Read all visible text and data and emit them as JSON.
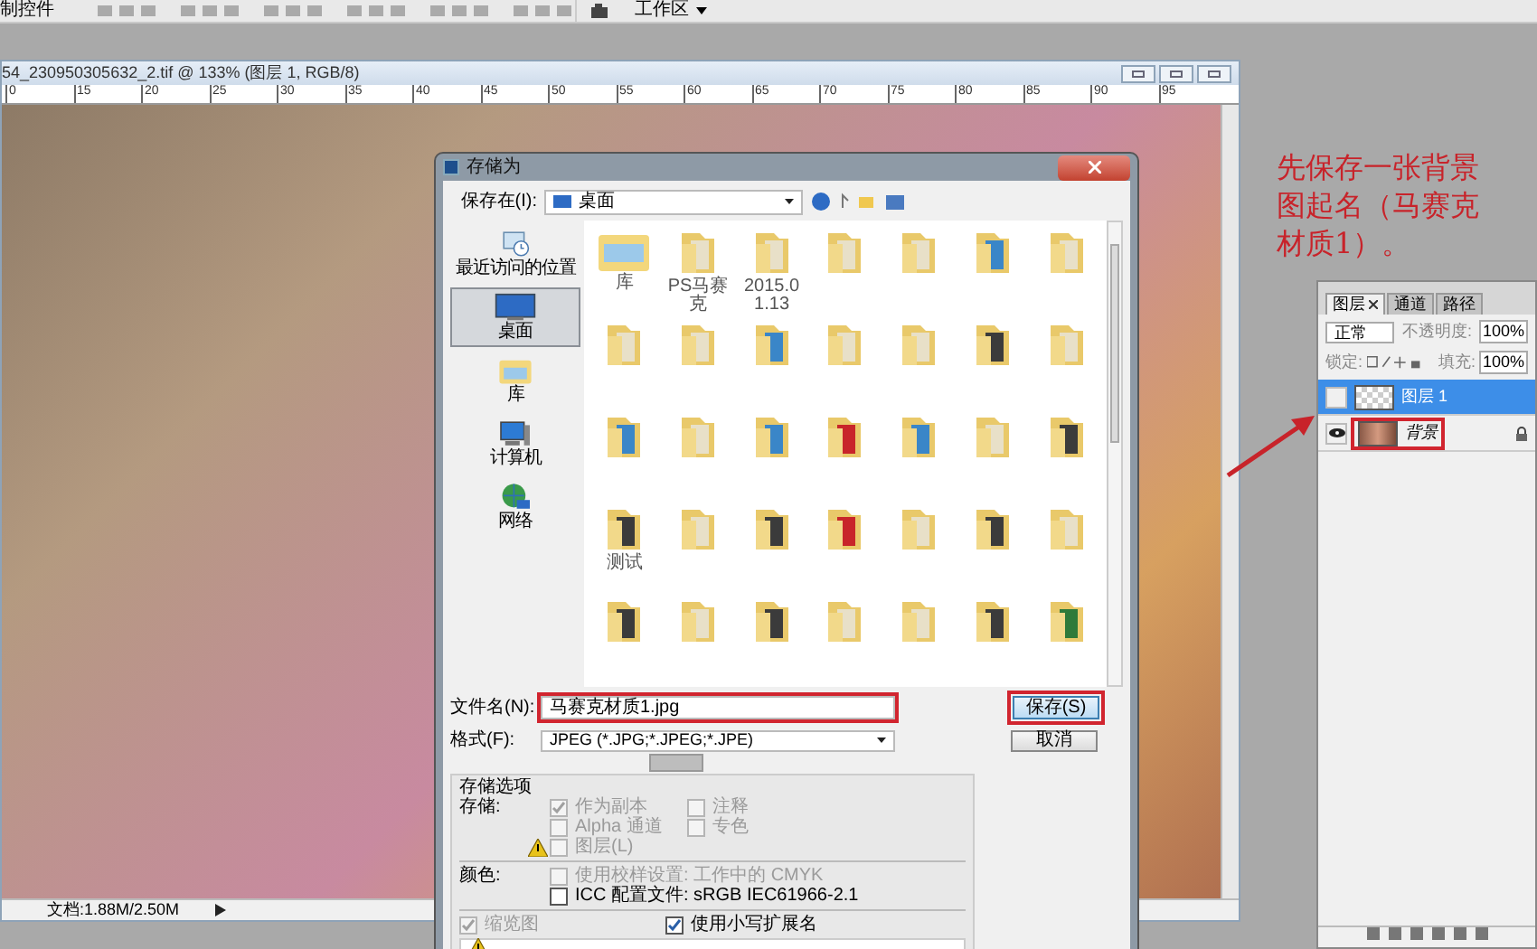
{
  "app_toolbar": {
    "label_fragment": "制控件",
    "workspace_menu": "工作区"
  },
  "document": {
    "title": "54_230950305632_2.tif @ 133% (图层 1, RGB/8)",
    "ruler_ticks": [
      "0",
      "15",
      "20",
      "25",
      "30",
      "35",
      "40",
      "45",
      "50",
      "55",
      "60",
      "65",
      "70",
      "75",
      "80",
      "85",
      "90",
      "95"
    ],
    "status": "文档:1.88M/2.50M"
  },
  "annotation": "先保存一张背景图起名（马赛克材质1）。",
  "dialog": {
    "title": "存储为",
    "location_label": "保存在(I):",
    "location": "桌面",
    "places": [
      {
        "label": "最近访问的位置",
        "kind": "recent",
        "selected": false
      },
      {
        "label": "桌面",
        "kind": "desktop",
        "selected": true
      },
      {
        "label": "库",
        "kind": "library",
        "selected": false
      },
      {
        "label": "计算机",
        "kind": "computer",
        "selected": false
      },
      {
        "label": "网络",
        "kind": "network",
        "selected": false
      }
    ],
    "files": [
      {
        "kind": "library",
        "label": "库"
      },
      {
        "kind": "folder",
        "label": "PS马赛克"
      },
      {
        "kind": "folder",
        "label": "2015.01.13"
      },
      {
        "kind": "folder"
      },
      {
        "kind": "folder"
      },
      {
        "kind": "media"
      },
      {
        "kind": "folder"
      },
      {
        "kind": "folder"
      },
      {
        "kind": "folder"
      },
      {
        "kind": "media"
      },
      {
        "kind": "folder"
      },
      {
        "kind": "folder"
      },
      {
        "kind": "dark"
      },
      {
        "kind": "folder"
      },
      {
        "kind": "media"
      },
      {
        "kind": "folder"
      },
      {
        "kind": "media"
      },
      {
        "kind": "red"
      },
      {
        "kind": "media"
      },
      {
        "kind": "folder"
      },
      {
        "kind": "dark"
      },
      {
        "kind": "dark",
        "label": "测试"
      },
      {
        "kind": "folder"
      },
      {
        "kind": "dark"
      },
      {
        "kind": "red"
      },
      {
        "kind": "folder"
      },
      {
        "kind": "dark"
      },
      {
        "kind": "folder"
      },
      {
        "kind": "dark"
      },
      {
        "kind": "folder"
      },
      {
        "kind": "dark"
      },
      {
        "kind": "folder"
      },
      {
        "kind": "folder"
      },
      {
        "kind": "dark"
      },
      {
        "kind": "green"
      }
    ],
    "filename_label": "文件名(N):",
    "filename": "马赛克材质1.jpg",
    "filename_highlighted": true,
    "format_label": "格式(F):",
    "format": "JPEG (*.JPG;*.JPEG;*.JPE)",
    "save_button": {
      "label": "保存(S)",
      "highlighted": true
    },
    "cancel_button": "取消",
    "options_title": "存储选项",
    "save_label": "存储:",
    "color_label": "颜色:",
    "save_options": [
      {
        "label": "作为副本",
        "checked": true,
        "disabled": true
      },
      {
        "label": "注释",
        "checked": false,
        "disabled": true
      },
      {
        "label": "Alpha 通道",
        "checked": false,
        "disabled": true
      },
      {
        "label": "专色",
        "checked": false,
        "disabled": true
      },
      {
        "label": "图层(L)",
        "checked": false,
        "disabled": true,
        "warning": true
      }
    ],
    "color_options": [
      {
        "label": "使用校样设置: 工作中的 CMYK",
        "checked": false,
        "disabled": true
      },
      {
        "label": "ICC 配置文件: sRGB IEC61966-2.1",
        "checked": false,
        "disabled": false
      }
    ],
    "bottom_options": [
      {
        "label": "缩览图",
        "checked": true,
        "disabled": true
      },
      {
        "label": "使用小写扩展名",
        "checked": true,
        "disabled": false
      }
    ]
  },
  "layers_panel": {
    "tabs": [
      {
        "label": "图层",
        "selected": true,
        "closable": true
      },
      {
        "label": "通道",
        "selected": false,
        "closable": false
      },
      {
        "label": "路径",
        "selected": false,
        "closable": false
      }
    ],
    "blend_mode": "正常",
    "opacity_label": "不透明度:",
    "opacity": "100%",
    "lock_label": "锁定:",
    "fill_label": "填充:",
    "fill": "100%",
    "layers": [
      {
        "name": "图层 1",
        "kind": "transparent",
        "visible": false,
        "selected": true,
        "locked": false,
        "highlighted": false
      },
      {
        "name": "背景",
        "kind": "photo",
        "visible": true,
        "selected": false,
        "locked": true,
        "highlighted": true
      }
    ]
  }
}
